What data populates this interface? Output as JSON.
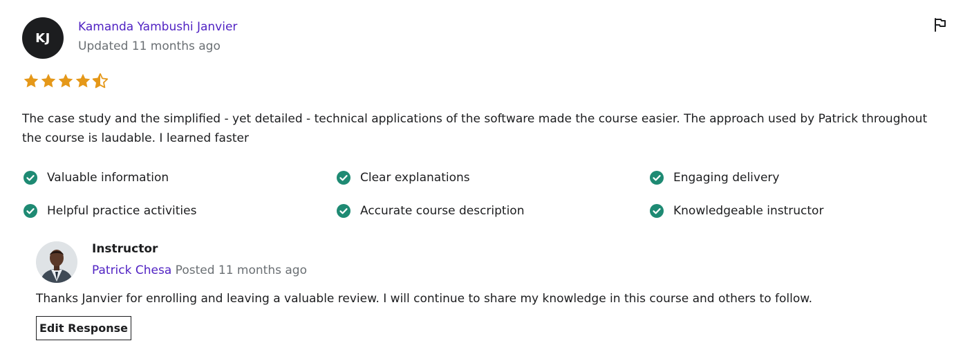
{
  "review": {
    "avatar_initials": "KJ",
    "reviewer_name": "Kamanda Yambushi Janvier",
    "updated": "Updated 11 months ago",
    "rating": 4.5,
    "star_color": "#e59819",
    "text": "The case study and the simplified - yet detailed - technical applications of the software made the course easier. The approach used by Patrick throughout the course is laudable. I learned faster",
    "report_icon": "flag-icon"
  },
  "tags": {
    "check_color": "#1e8a73",
    "items": [
      "Valuable information",
      "Clear explanations",
      "Engaging delivery",
      "Helpful practice activities",
      "Accurate course description",
      "Knowledgeable instructor"
    ]
  },
  "instructor_response": {
    "title": "Instructor",
    "name": "Patrick Chesa",
    "posted": "Posted 11 months ago",
    "text": "Thanks Janvier for enrolling and leaving a valuable review. I will continue to share my knowledge in this course and others to follow.",
    "edit_label": "Edit Response"
  }
}
